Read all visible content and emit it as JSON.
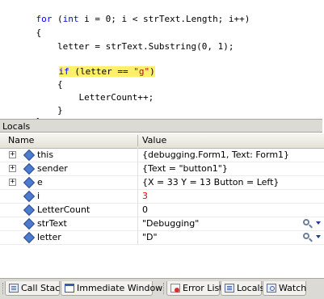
{
  "code": {
    "lines": [
      {
        "kw1": "for",
        "txt1": " (",
        "kw2": "int",
        "txt2": " i = 0; i < strText.Length; i++)"
      },
      {
        "txt1": "{"
      },
      {
        "txt1": "    letter = strText.Substring(0, 1);"
      },
      {
        "kw1": "if",
        "txt1": " (letter == ",
        "str": "\"g\"",
        "txt2": ")"
      },
      {
        "txt1": "    {"
      },
      {
        "txt1": "        LetterCount++;"
      },
      {
        "txt1": "    }"
      },
      {
        "txt1": "}"
      }
    ],
    "highlight_color": "#ffef69"
  },
  "locals": {
    "title": "Locals",
    "columns": {
      "name": "Name",
      "value": "Value"
    },
    "rows": [
      {
        "name": "this",
        "value": "{debugging.Form1, Text: Form1}",
        "expandable": "+"
      },
      {
        "name": "sender",
        "value": "{Text = \"button1\"}",
        "expandable": "+"
      },
      {
        "name": "e",
        "value": "{X = 33 Y = 13 Button = Left}",
        "expandable": "+"
      },
      {
        "name": "i",
        "value": "3"
      },
      {
        "name": "LetterCount",
        "value": "0"
      },
      {
        "name": "strText",
        "value": "\"Debugging\""
      },
      {
        "name": "letter",
        "value": "\"D\""
      }
    ],
    "changed_value_color": "#ff0000"
  },
  "tabs": {
    "call_stack": "Call Stack",
    "immediate": "Immediate Window",
    "error_list": "Error List",
    "locals": "Locals",
    "watch": "Watch"
  }
}
